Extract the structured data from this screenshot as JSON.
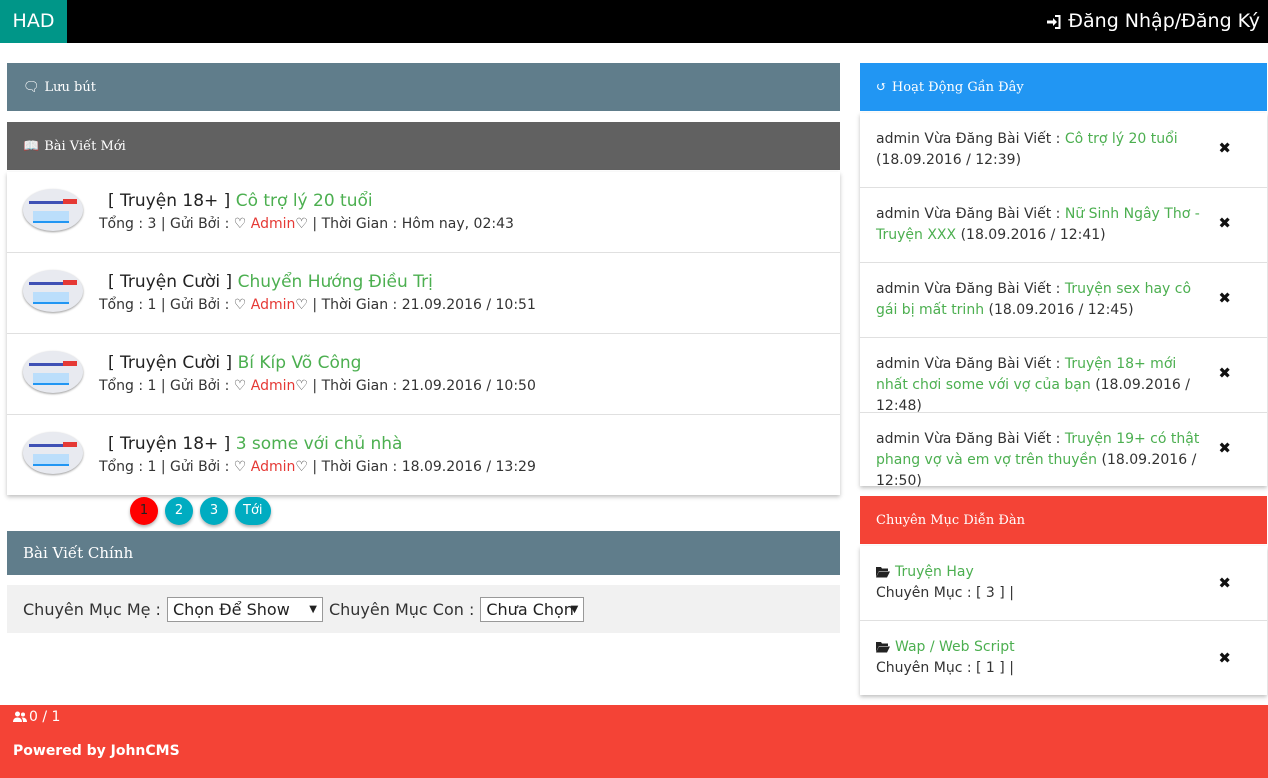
{
  "header": {
    "logo": "HAD",
    "login_label": "Đăng Nhập/Đăng Ký"
  },
  "panels": {
    "luubut": "Lưu bút",
    "bai_viet_moi": "Bài Viết Mới",
    "bai_viet_chinh": "Bài Viết Chính",
    "hoat_dong": "Hoạt Động Gần Đây",
    "chuyen_muc": "Chuyên Mục Diễn Đàn"
  },
  "posts": [
    {
      "category": "[ Truyện 18+ ]",
      "title": "Cô trợ lý 20 tuổi",
      "meta_prefix": "Tổng : 3 | Gửi Bởi : ",
      "author": "Admin",
      "meta_suffix": " | Thời Gian : Hôm nay, 02:43"
    },
    {
      "category": "[ Truyện Cười ]",
      "title": "Chuyển Hướng Điều Trị",
      "meta_prefix": "Tổng : 1 | Gửi Bởi : ",
      "author": "Admin",
      "meta_suffix": " | Thời Gian : 21.09.2016 / 10:51"
    },
    {
      "category": "[ Truyện Cười ]",
      "title": "Bí Kíp Võ Công",
      "meta_prefix": "Tổng : 1 | Gửi Bởi : ",
      "author": "Admin",
      "meta_suffix": " | Thời Gian : 21.09.2016 / 10:50"
    },
    {
      "category": "[ Truyện 18+ ]",
      "title": "3 some với chủ nhà",
      "meta_prefix": "Tổng : 1 | Gửi Bởi : ",
      "author": "Admin",
      "meta_suffix": " | Thời Gian : 18.09.2016 / 13:29"
    }
  ],
  "pagination": [
    "1",
    "2",
    "3",
    "Tới"
  ],
  "filter": {
    "parent_label": "Chuyên Mục Mẹ :",
    "parent_value": "Chọn Để Show",
    "child_label": "Chuyên Mục Con :",
    "child_value": "Chưa Chọn"
  },
  "activity": [
    {
      "prefix": "admin Vừa Đăng Bài Viết : ",
      "link": "Cô trợ lý 20 tuổi",
      "time": "(18.09.2016 / 12:39)"
    },
    {
      "prefix": "admin Vừa Đăng Bài Viết : ",
      "link": "Nữ Sinh Ngây Thơ - Truyện XXX",
      "time": "(18.09.2016 / 12:41)"
    },
    {
      "prefix": "admin Vừa Đăng Bài Viết : ",
      "link": "Truyện sex hay cô gái bị mất trinh",
      "time": "(18.09.2016 / 12:45)"
    },
    {
      "prefix": "admin Vừa Đăng Bài Viết : ",
      "link": "Truyện 18+ mới nhất chơi some với vợ của bạn",
      "time": "(18.09.2016 / 12:48)"
    },
    {
      "prefix": "admin Vừa Đăng Bài Viết : ",
      "link": "Truyện 19+ có thật phang vợ và em vợ trên thuyền",
      "time": "(18.09.2016 / 12:50)"
    }
  ],
  "close_glyph": "✖",
  "categories": [
    {
      "name": "Truyện Hay",
      "meta": "Chuyên Mục : [ 3 ] |"
    },
    {
      "name": "Wap / Web Script",
      "meta": "Chuyên Mục : [ 1 ] |"
    }
  ],
  "footer": {
    "online": "0 / 1",
    "powered": "Powered by JohnCMS"
  },
  "colors": {
    "logo_bg": "#009688",
    "luubut_bg": "#607d8b",
    "baiviet_bg": "#616161",
    "hoatdong_bg": "#2196f3",
    "chuyenmuc_bg": "#f44336",
    "link": "#4caf50",
    "author": "#e53935",
    "pager": "#00acc1",
    "pager_active": "#ff0000",
    "footer_bg": "#f44336"
  }
}
